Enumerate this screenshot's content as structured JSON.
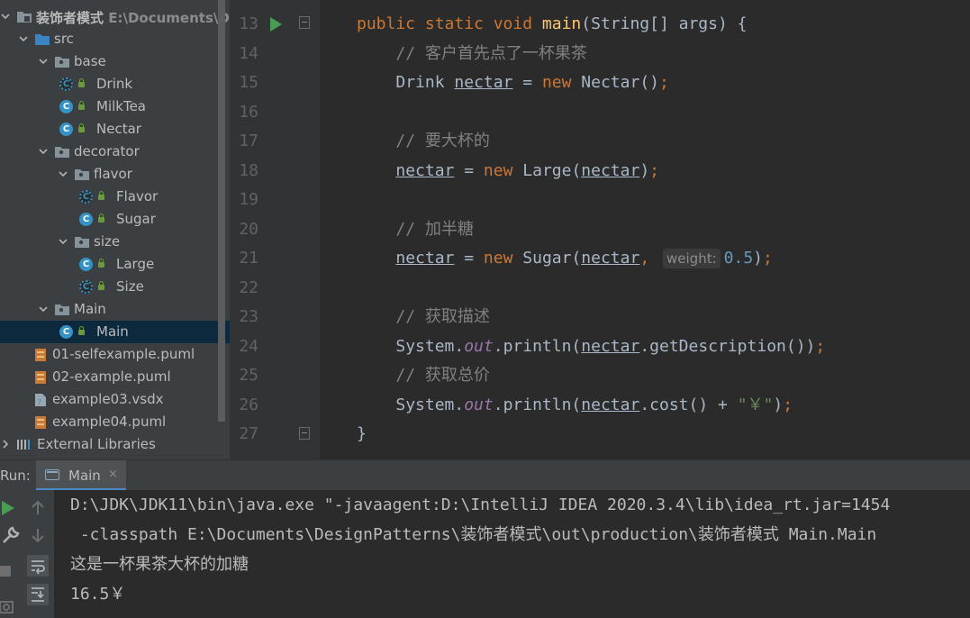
{
  "project_tree": [
    {
      "label": "装饰者模式",
      "path": " E:\\Documents\\Des",
      "level": 0,
      "type": "module",
      "expanded": true,
      "bold": true
    },
    {
      "label": "src",
      "level": 1,
      "type": "source-folder",
      "expanded": true
    },
    {
      "label": "base",
      "level": 2,
      "type": "package",
      "expanded": true
    },
    {
      "label": "Drink",
      "level": 3,
      "type": "abstract-class"
    },
    {
      "label": "MilkTea",
      "level": 3,
      "type": "class"
    },
    {
      "label": "Nectar",
      "level": 3,
      "type": "class"
    },
    {
      "label": "decorator",
      "level": 2,
      "type": "package",
      "expanded": true
    },
    {
      "label": "flavor",
      "level": 3,
      "type": "package",
      "expanded": true
    },
    {
      "label": "Flavor",
      "level": 4,
      "type": "abstract-class"
    },
    {
      "label": "Sugar",
      "level": 4,
      "type": "class"
    },
    {
      "label": "size",
      "level": 3,
      "type": "package",
      "expanded": true
    },
    {
      "label": "Large",
      "level": 4,
      "type": "class"
    },
    {
      "label": "Size",
      "level": 4,
      "type": "abstract-class"
    },
    {
      "label": "Main",
      "level": 2,
      "type": "package",
      "expanded": true
    },
    {
      "label": "Main",
      "level": 3,
      "type": "main-class",
      "selected": true
    },
    {
      "label": "01-selfexample.puml",
      "level": 1,
      "type": "puml"
    },
    {
      "label": "02-example.puml",
      "level": 1,
      "type": "puml"
    },
    {
      "label": "example03.vsdx",
      "level": 1,
      "type": "unknown-file"
    },
    {
      "label": "example04.puml",
      "level": 1,
      "type": "puml"
    },
    {
      "label": "External Libraries",
      "level": 0,
      "type": "libraries",
      "expanded": false
    }
  ],
  "editor": {
    "line_numbers": [
      "13",
      "14",
      "15",
      "16",
      "17",
      "18",
      "19",
      "20",
      "21",
      "22",
      "23",
      "24",
      "25",
      "26",
      "27"
    ],
    "code": {
      "l13": {
        "indent": "",
        "kw1": "public static void ",
        "fn": "main",
        "rest": "(String[] args) {"
      },
      "l14": {
        "indent": "    ",
        "comment": "// 客户首先点了一杯果茶"
      },
      "l15": {
        "indent": "    ",
        "type": "Drink ",
        "var": "nectar",
        "eq": " = ",
        "kw": "new ",
        "call": "Nectar()",
        "semi": ";"
      },
      "l17": {
        "indent": "    ",
        "comment": "// 要大杯的"
      },
      "l18": {
        "indent": "    ",
        "var": "nectar",
        "eq": " = ",
        "kw": "new ",
        "call": "Large(",
        "arg": "nectar",
        "close": ")",
        "semi": ";"
      },
      "l20": {
        "indent": "    ",
        "comment": "// 加半糖"
      },
      "l21": {
        "indent": "    ",
        "var": "nectar",
        "eq": " = ",
        "kw": "new ",
        "call": "Sugar(",
        "arg": "nectar",
        "comma": ", ",
        "hint": "weight:",
        "num": "0.5",
        "close": ")",
        "semi": ";"
      },
      "l23": {
        "indent": "    ",
        "comment": "// 获取描述"
      },
      "l24": {
        "indent": "    ",
        "obj": "System.",
        "field": "out",
        "call": ".println(",
        "arg": "nectar",
        "tail": ".getDescription())",
        "semi": ";"
      },
      "l25": {
        "indent": "    ",
        "comment": "// 获取总价"
      },
      "l26": {
        "indent": "    ",
        "obj": "System.",
        "field": "out",
        "call": ".println(",
        "arg": "nectar",
        "tail": ".cost() + ",
        "str": "\"￥\"",
        "close": ")",
        "semi": ";"
      },
      "l27": {
        "indent": "",
        "brace": "}"
      }
    }
  },
  "run": {
    "label": "Run:",
    "tab_label": "Main",
    "tab_close": "×",
    "console_lines": [
      "D:\\JDK\\JDK11\\bin\\java.exe \"-javaagent:D:\\IntelliJ IDEA 2020.3.4\\lib\\idea_rt.jar=1454",
      " -classpath E:\\Documents\\DesignPatterns\\装饰者模式\\out\\production\\装饰者模式 Main.Main",
      "这是一杯果茶大杯的加糖",
      "16.5￥"
    ]
  },
  "colors": {
    "keyword": "#cc7832",
    "function": "#ffc66d",
    "comment": "#808080",
    "string": "#6a8759",
    "number": "#6897bb",
    "static_field": "#9876aa",
    "selection": "#0d293e"
  }
}
